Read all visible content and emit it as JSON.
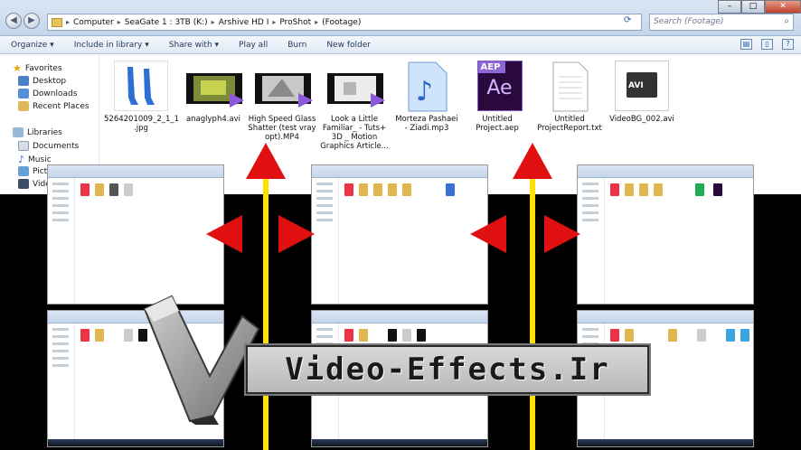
{
  "window": {
    "controls": {
      "minimize": "–",
      "maximize": "□",
      "close": "✕"
    }
  },
  "address": {
    "crumbs": [
      "Computer",
      "SeaGate 1 : 3TB (K:)",
      "Arshive HD I",
      "ProShot",
      "(Footage)"
    ],
    "separator": "▸"
  },
  "search": {
    "placeholder": "Search (Footage)",
    "icon": "search-icon"
  },
  "toolbar": {
    "organize": "Organize ▾",
    "include": "Include in library ▾",
    "share": "Share with ▾",
    "play_all": "Play all",
    "burn": "Burn",
    "new_folder": "New folder"
  },
  "sidebar": {
    "favorites": "Favorites",
    "desktop": "Desktop",
    "downloads": "Downloads",
    "recent": "Recent Places",
    "libraries": "Libraries",
    "documents": "Documents",
    "music": "Music",
    "pictures": "Pictu",
    "videos": "Vide"
  },
  "files": [
    {
      "name": "5264201009_2_1_1\n.jpg",
      "kind": "image"
    },
    {
      "name": "anaglyph4.avi",
      "kind": "video"
    },
    {
      "name": "High Speed Glass\nShatter (test vray\nopt).MP4",
      "kind": "video-glass"
    },
    {
      "name": "Look a Little\nFamiliar_ - Tuts+\n3D _ Motion\nGraphics Article...",
      "kind": "video-white"
    },
    {
      "name": "Morteza Pashaei\n- Ziadi.mp3",
      "kind": "audio"
    },
    {
      "name": "Untitled\nProject.aep",
      "kind": "aep",
      "badge": "AEP",
      "letters": "Ae"
    },
    {
      "name": "Untitled\nProjectReport.txt",
      "kind": "text"
    },
    {
      "name": "VideoBG_002.avi",
      "kind": "avi",
      "badge": "AVI"
    }
  ],
  "watermark": {
    "text": "Video-Effects.Ir"
  },
  "colors": {
    "arrow": "#e01010",
    "line": "#ffe100",
    "aep": "#2a0a3d"
  }
}
